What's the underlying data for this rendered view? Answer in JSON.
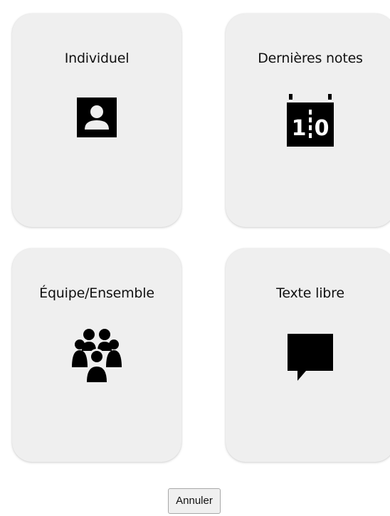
{
  "cards": [
    {
      "title": "Individuel",
      "icon": "person-icon"
    },
    {
      "title": "Dernières notes",
      "icon": "scoreboard-icon",
      "score_left": "1",
      "score_right": "0"
    },
    {
      "title": "Équipe/Ensemble",
      "icon": "group-icon"
    },
    {
      "title": "Texte libre",
      "icon": "speech-bubble-icon"
    }
  ],
  "cancel_label": "Annuler",
  "colors": {
    "card_background": "#efefef",
    "icon": "#000000",
    "button_background": "#f0f0f0"
  }
}
